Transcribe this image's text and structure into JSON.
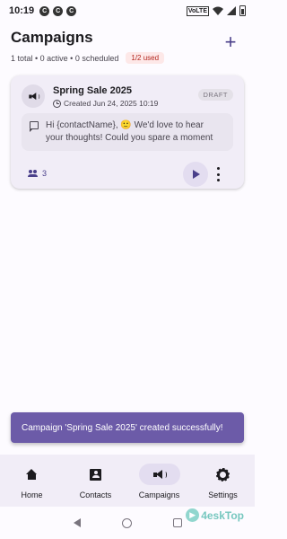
{
  "status_bar": {
    "time": "10:19",
    "notif_icons": [
      "C",
      "C",
      "C"
    ],
    "volte": "VoLTE"
  },
  "header": {
    "title": "Campaigns",
    "summary": "1 total • 0 active • 0 scheduled",
    "usage_badge": "1/2 used",
    "add_icon": "plus-icon"
  },
  "campaigns": [
    {
      "name": "Spring Sale 2025",
      "created": "Created Jun 24, 2025 10:19",
      "status": "DRAFT",
      "message_line1": "Hi {contactName}, 🙂 We'd love to hear",
      "message_line2": "your thoughts! Could you spare a moment",
      "recipient_count": "3"
    }
  ],
  "snackbar": {
    "message": "Campaign 'Spring Sale 2025' created successfully!"
  },
  "bottom_nav": {
    "items": [
      {
        "label": "Home",
        "icon": "home-icon",
        "active": false
      },
      {
        "label": "Contacts",
        "icon": "contacts-icon",
        "active": false
      },
      {
        "label": "Campaigns",
        "icon": "megaphone-icon",
        "active": true
      },
      {
        "label": "Settings",
        "icon": "gear-icon",
        "active": false
      }
    ]
  },
  "watermark": {
    "text": "4eskTop"
  },
  "colors": {
    "accent": "#4a3f8a",
    "snackbar": "#6c5ba8",
    "card_bg": "#f1edf7",
    "badge_red": "#b3261e"
  }
}
